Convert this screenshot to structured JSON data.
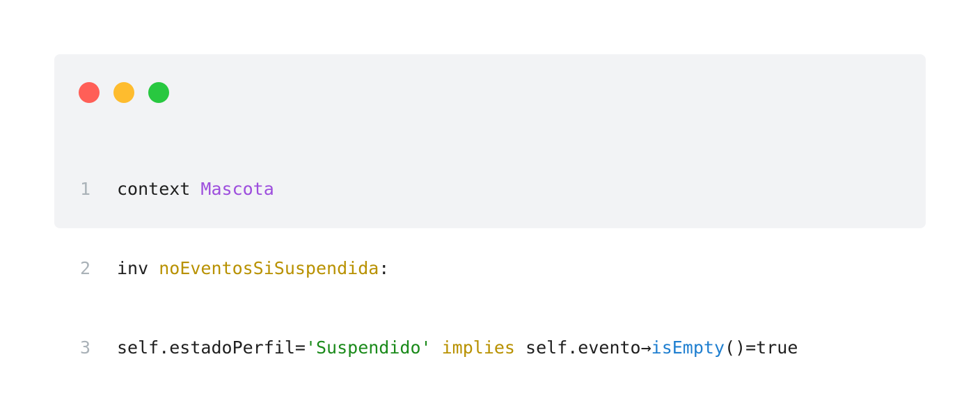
{
  "window": {
    "buttons": [
      {
        "name": "close",
        "color": "#ff5f57"
      },
      {
        "name": "minimize",
        "color": "#febc2e"
      },
      {
        "name": "maximize",
        "color": "#28c840"
      }
    ]
  },
  "colors": {
    "plain": "#1f1f1f",
    "type": "#9d4edd",
    "identifier": "#b89100",
    "string": "#1a8a1a",
    "keyword": "#b89100",
    "method": "#1f7fd0",
    "line_number": "#aab2b8"
  },
  "code": {
    "lines": [
      {
        "number": "1",
        "tokens": [
          {
            "text": "context ",
            "kind": "plain"
          },
          {
            "text": "Mascota",
            "kind": "type"
          }
        ]
      },
      {
        "number": "2",
        "tokens": [
          {
            "text": "inv ",
            "kind": "plain"
          },
          {
            "text": "noEventosSiSuspendida",
            "kind": "identifier"
          },
          {
            "text": ":",
            "kind": "plain"
          }
        ]
      },
      {
        "number": "3",
        "tokens": [
          {
            "text": "self.estadoPerfil=",
            "kind": "plain"
          },
          {
            "text": "'Suspendido'",
            "kind": "string"
          },
          {
            "text": " ",
            "kind": "plain"
          },
          {
            "text": "implies",
            "kind": "keyword"
          },
          {
            "text": " self.evento→",
            "kind": "plain"
          },
          {
            "text": "isEmpty",
            "kind": "method"
          },
          {
            "text": "()=true",
            "kind": "plain"
          }
        ]
      }
    ]
  }
}
